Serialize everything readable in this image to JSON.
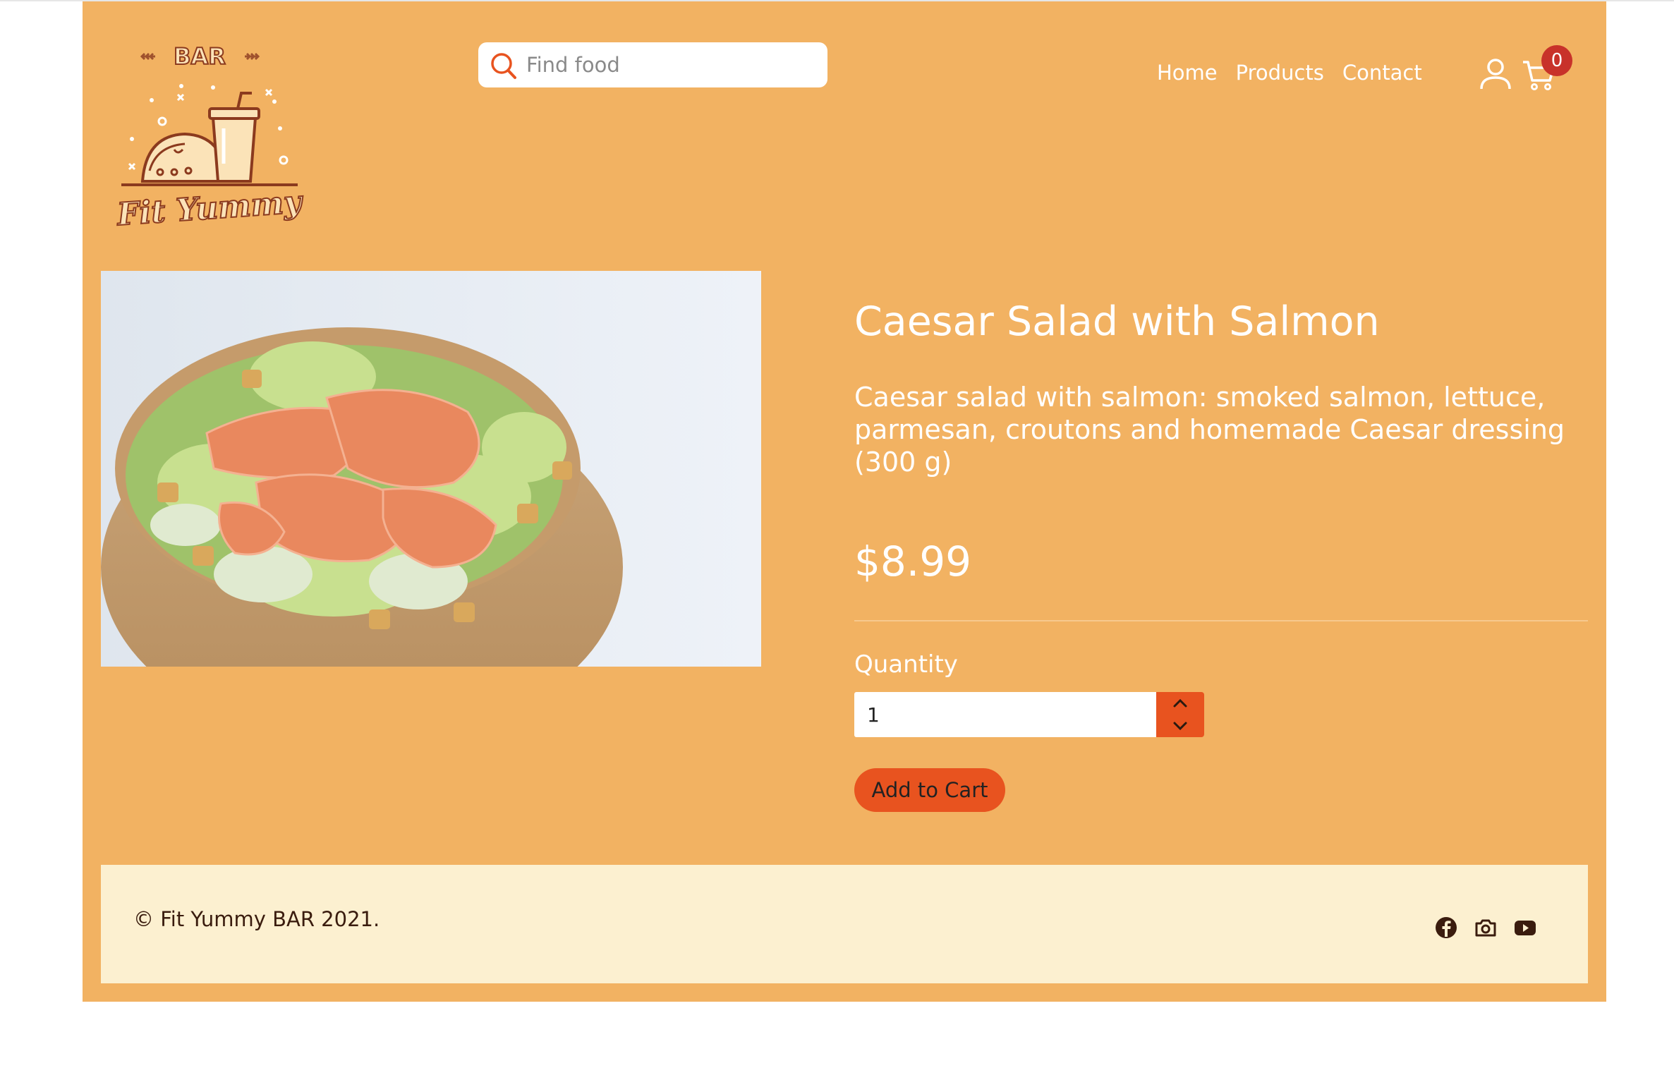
{
  "brand": {
    "logo_top": "BAR",
    "logo_name": "Fit Yummy"
  },
  "search": {
    "placeholder": "Find food"
  },
  "nav": {
    "items": [
      "Home",
      "Products",
      "Contact"
    ]
  },
  "cart": {
    "count": "0"
  },
  "product": {
    "title": "Caesar Salad with Salmon",
    "description": "Caesar salad with salmon: smoked salmon, lettuce, parmesan, croutons and homemade Caesar dressing (300 g)",
    "price": "$8.99",
    "quantity_label": "Quantity",
    "quantity_value": "1",
    "add_to_cart_label": "Add to Cart"
  },
  "footer": {
    "copyright": "© Fit Yummy BAR 2021."
  },
  "colors": {
    "page_bg": "#f2b262",
    "accent": "#e8531f",
    "badge": "#c8322a",
    "footer_bg": "#fcf0d0",
    "footer_text": "#3a1c0e"
  }
}
